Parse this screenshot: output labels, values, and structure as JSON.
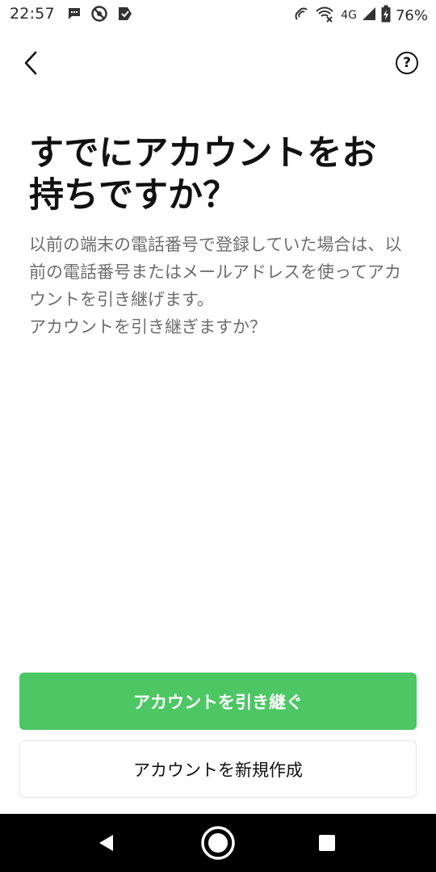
{
  "status_bar": {
    "time": "22:57",
    "network": "4G",
    "battery": "76%",
    "icons": [
      "message-icon",
      "no-disturb-icon",
      "check-flag-icon",
      "nfc-icon",
      "wifi-icon",
      "signal-icon",
      "battery-icon"
    ]
  },
  "header": {
    "help_label": "?"
  },
  "content": {
    "title": "すでにアカウントをお持ちですか？",
    "description": "以前の端末の電話番号で登録していた場合は、以前の電話番号またはメールアドレスを使ってアカウントを引き継げます。\nアカウントを引き継ぎますか？"
  },
  "actions": {
    "transfer_label": "アカウントを引き継ぐ",
    "create_label": "アカウントを新規作成",
    "primary_color": "#4cc764"
  }
}
